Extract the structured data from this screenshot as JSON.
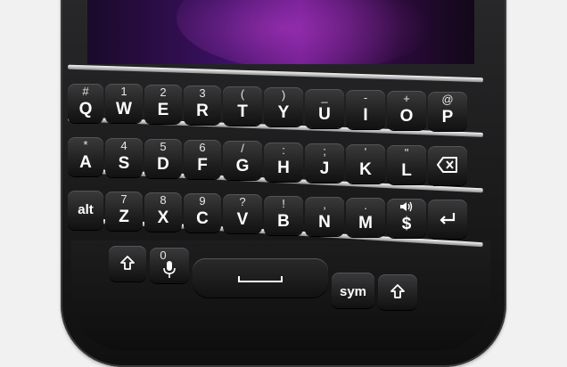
{
  "keyboard": {
    "row1": [
      {
        "alt": "#",
        "main": "Q"
      },
      {
        "alt": "1",
        "main": "W"
      },
      {
        "alt": "2",
        "main": "E"
      },
      {
        "alt": "3",
        "main": "R"
      },
      {
        "alt": "(",
        "main": "T"
      },
      {
        "alt": ")",
        "main": "Y"
      },
      {
        "alt": "_",
        "main": "U"
      },
      {
        "alt": "-",
        "main": "I"
      },
      {
        "alt": "+",
        "main": "O"
      },
      {
        "alt": "@",
        "main": "P"
      }
    ],
    "row2": [
      {
        "alt": "*",
        "main": "A"
      },
      {
        "alt": "4",
        "main": "S"
      },
      {
        "alt": "5",
        "main": "D"
      },
      {
        "alt": "6",
        "main": "F"
      },
      {
        "alt": "/",
        "main": "G"
      },
      {
        "alt": ":",
        "main": "H"
      },
      {
        "alt": ";",
        "main": "J"
      },
      {
        "alt": "'",
        "main": "K"
      },
      {
        "alt": "\"",
        "main": "L"
      }
    ],
    "row3": [
      {
        "alt": "",
        "main": "alt"
      },
      {
        "alt": "7",
        "main": "Z"
      },
      {
        "alt": "8",
        "main": "X"
      },
      {
        "alt": "9",
        "main": "C"
      },
      {
        "alt": "?",
        "main": "V"
      },
      {
        "alt": "!",
        "main": "B"
      },
      {
        "alt": ",",
        "main": "N"
      },
      {
        "alt": ".",
        "main": "M"
      },
      {
        "alt": "",
        "main": "$"
      }
    ],
    "row4": {
      "mic_key_alt": "0",
      "sym_label": "sym"
    }
  }
}
